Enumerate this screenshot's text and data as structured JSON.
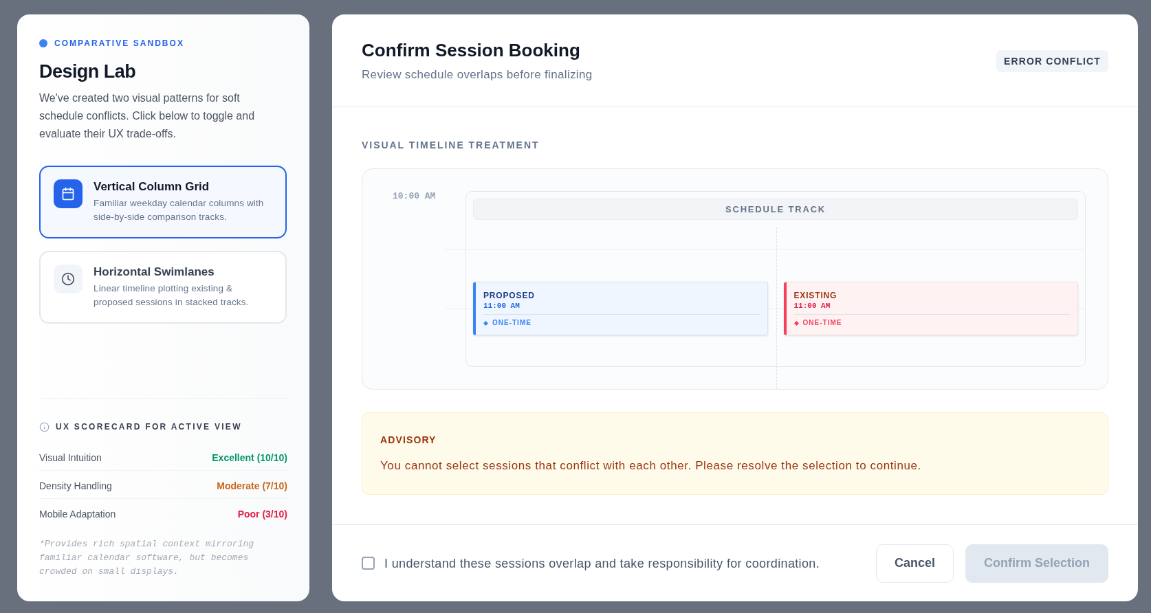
{
  "sidebar": {
    "eyebrow": "COMPARATIVE SANDBOX",
    "title": "Design Lab",
    "description": "We've created two visual patterns for soft schedule conflicts. Click below to toggle and evaluate their UX trade-offs.",
    "options": [
      {
        "title": "Vertical Column Grid",
        "description": "Familiar weekday calendar columns with side-by-side comparison tracks.",
        "selected": true
      },
      {
        "title": "Horizontal Swimlanes",
        "description": "Linear timeline plotting existing & proposed sessions in stacked tracks.",
        "selected": false
      }
    ],
    "scorecard": {
      "title": "UX SCORECARD FOR ACTIVE VIEW",
      "rows": [
        {
          "label": "Visual Intuition",
          "value": "Excellent (10/10)",
          "color": "#059669"
        },
        {
          "label": "Density Handling",
          "value": "Moderate (7/10)",
          "color": "#c9671c"
        },
        {
          "label": "Mobile Adaptation",
          "value": "Poor (3/10)",
          "color": "#e11d48"
        }
      ],
      "footnote": "*Provides rich spatial context mirroring familiar calendar software, but becomes crowded on small displays."
    }
  },
  "dialog": {
    "title": "Confirm Session Booking",
    "subtitle": "Review schedule overlaps before finalizing",
    "badge": "ERROR CONFLICT",
    "section_label": "VISUAL TIMELINE TREATMENT",
    "timeline": {
      "time_labels": [
        "10:00 AM"
      ],
      "track_title": "SCHEDULE TRACK",
      "sessions": [
        {
          "kind": "proposed",
          "label": "PROPOSED",
          "time": "11:00 AM",
          "recurrence": "ONE-TIME"
        },
        {
          "kind": "existing",
          "label": "EXISTING",
          "time": "11:00 AM",
          "recurrence": "ONE-TIME"
        }
      ]
    },
    "advisory": {
      "title": "ADVISORY",
      "message": "You cannot select sessions that conflict with each other. Please resolve the selection to continue."
    },
    "footer": {
      "acknowledge": {
        "label": "I understand these sessions overlap and take responsibility for coordination.",
        "checked": false
      },
      "buttons": [
        {
          "kind": "secondary",
          "label": "Cancel",
          "disabled": false
        },
        {
          "kind": "primary",
          "label": "Confirm Selection",
          "disabled": true
        }
      ]
    }
  }
}
